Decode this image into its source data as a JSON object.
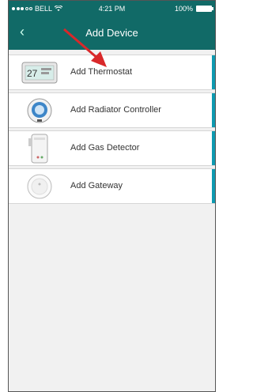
{
  "status": {
    "carrier": "BELL",
    "time": "4:21 PM",
    "battery": "100%"
  },
  "header": {
    "back_icon": "chevron-left-icon",
    "title": "Add Device"
  },
  "devices": [
    {
      "label": "Add Thermostat",
      "thumb_text": "27"
    },
    {
      "label": "Add Radiator Controller"
    },
    {
      "label": "Add Gas Detector"
    },
    {
      "label": "Add Gateway"
    }
  ],
  "colors": {
    "nav": "#116a67",
    "accent": "#0e9ab0",
    "arrow": "#d9282a"
  }
}
